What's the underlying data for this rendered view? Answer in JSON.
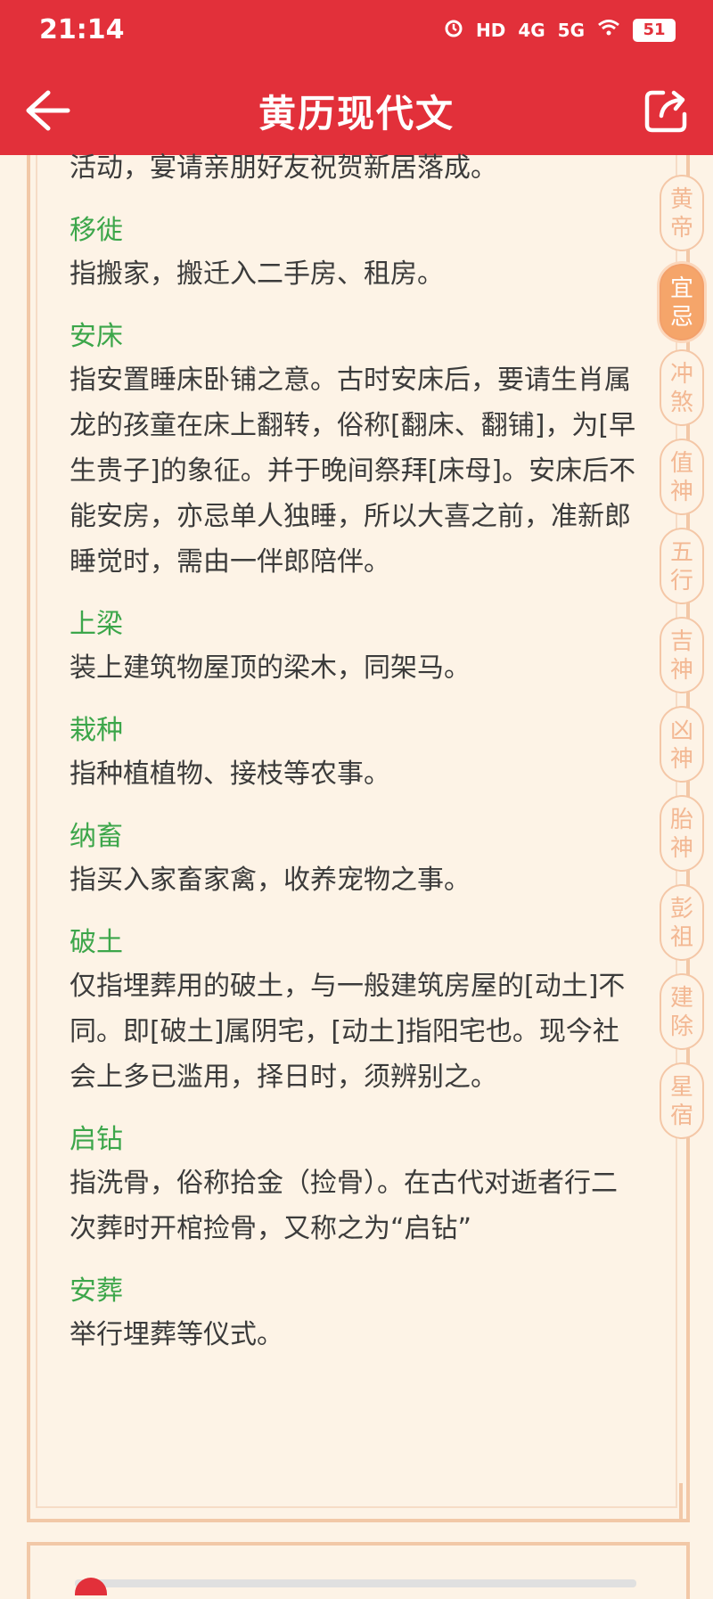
{
  "status_bar": {
    "time": "21:14",
    "hd": "HD",
    "signal1": "4G",
    "signal2": "5G",
    "battery": "51"
  },
  "nav": {
    "title": "黄历现代文"
  },
  "content": {
    "first_line": "活动，宴请亲朋好友祝贺新居落成。",
    "entries": [
      {
        "term": "移徙",
        "desc": "指搬家，搬迁入二手房、租房。"
      },
      {
        "term": "安床",
        "desc": "指安置睡床卧铺之意。古时安床后，要请生肖属龙的孩童在床上翻转，俗称[翻床、翻铺]，为[早生贵子]的象征。并于晚间祭拜[床母]。安床后不能安房，亦忌单人独睡，所以大喜之前，准新郎睡觉时，需由一伴郎陪伴。"
      },
      {
        "term": "上梁",
        "desc": "装上建筑物屋顶的梁木，同架马。"
      },
      {
        "term": "栽种",
        "desc": "指种植植物、接枝等农事。"
      },
      {
        "term": "纳畜",
        "desc": "指买入家畜家禽，收养宠物之事。"
      },
      {
        "term": "破土",
        "desc": "仅指埋葬用的破土，与一般建筑房屋的[动土]不同。即[破土]属阴宅，[动土]指阳宅也。现今社会上多已滥用，择日时，须辨别之。"
      },
      {
        "term": "启钻",
        "desc": "指洗骨，俗称拾金（捡骨）。在古代对逝者行二次葬时开棺捡骨，又称之为“启钻”"
      },
      {
        "term": "安葬",
        "desc": "举行埋葬等仪式。"
      }
    ]
  },
  "side_tabs": [
    {
      "a": "黄",
      "b": "帝",
      "active": false
    },
    {
      "a": "宜",
      "b": "忌",
      "active": true
    },
    {
      "a": "冲",
      "b": "煞",
      "active": false
    },
    {
      "a": "值",
      "b": "神",
      "active": false
    },
    {
      "a": "五",
      "b": "行",
      "active": false
    },
    {
      "a": "吉",
      "b": "神",
      "active": false
    },
    {
      "a": "凶",
      "b": "神",
      "active": false
    },
    {
      "a": "胎",
      "b": "神",
      "active": false
    },
    {
      "a": "彭",
      "b": "祖",
      "active": false
    },
    {
      "a": "建",
      "b": "除",
      "active": false
    },
    {
      "a": "星",
      "b": "宿",
      "active": false
    }
  ],
  "colors": {
    "header": "#e2303a",
    "term": "#3ca64a",
    "tab_active": "#f5a56a",
    "frame": "#f2c8a7"
  }
}
